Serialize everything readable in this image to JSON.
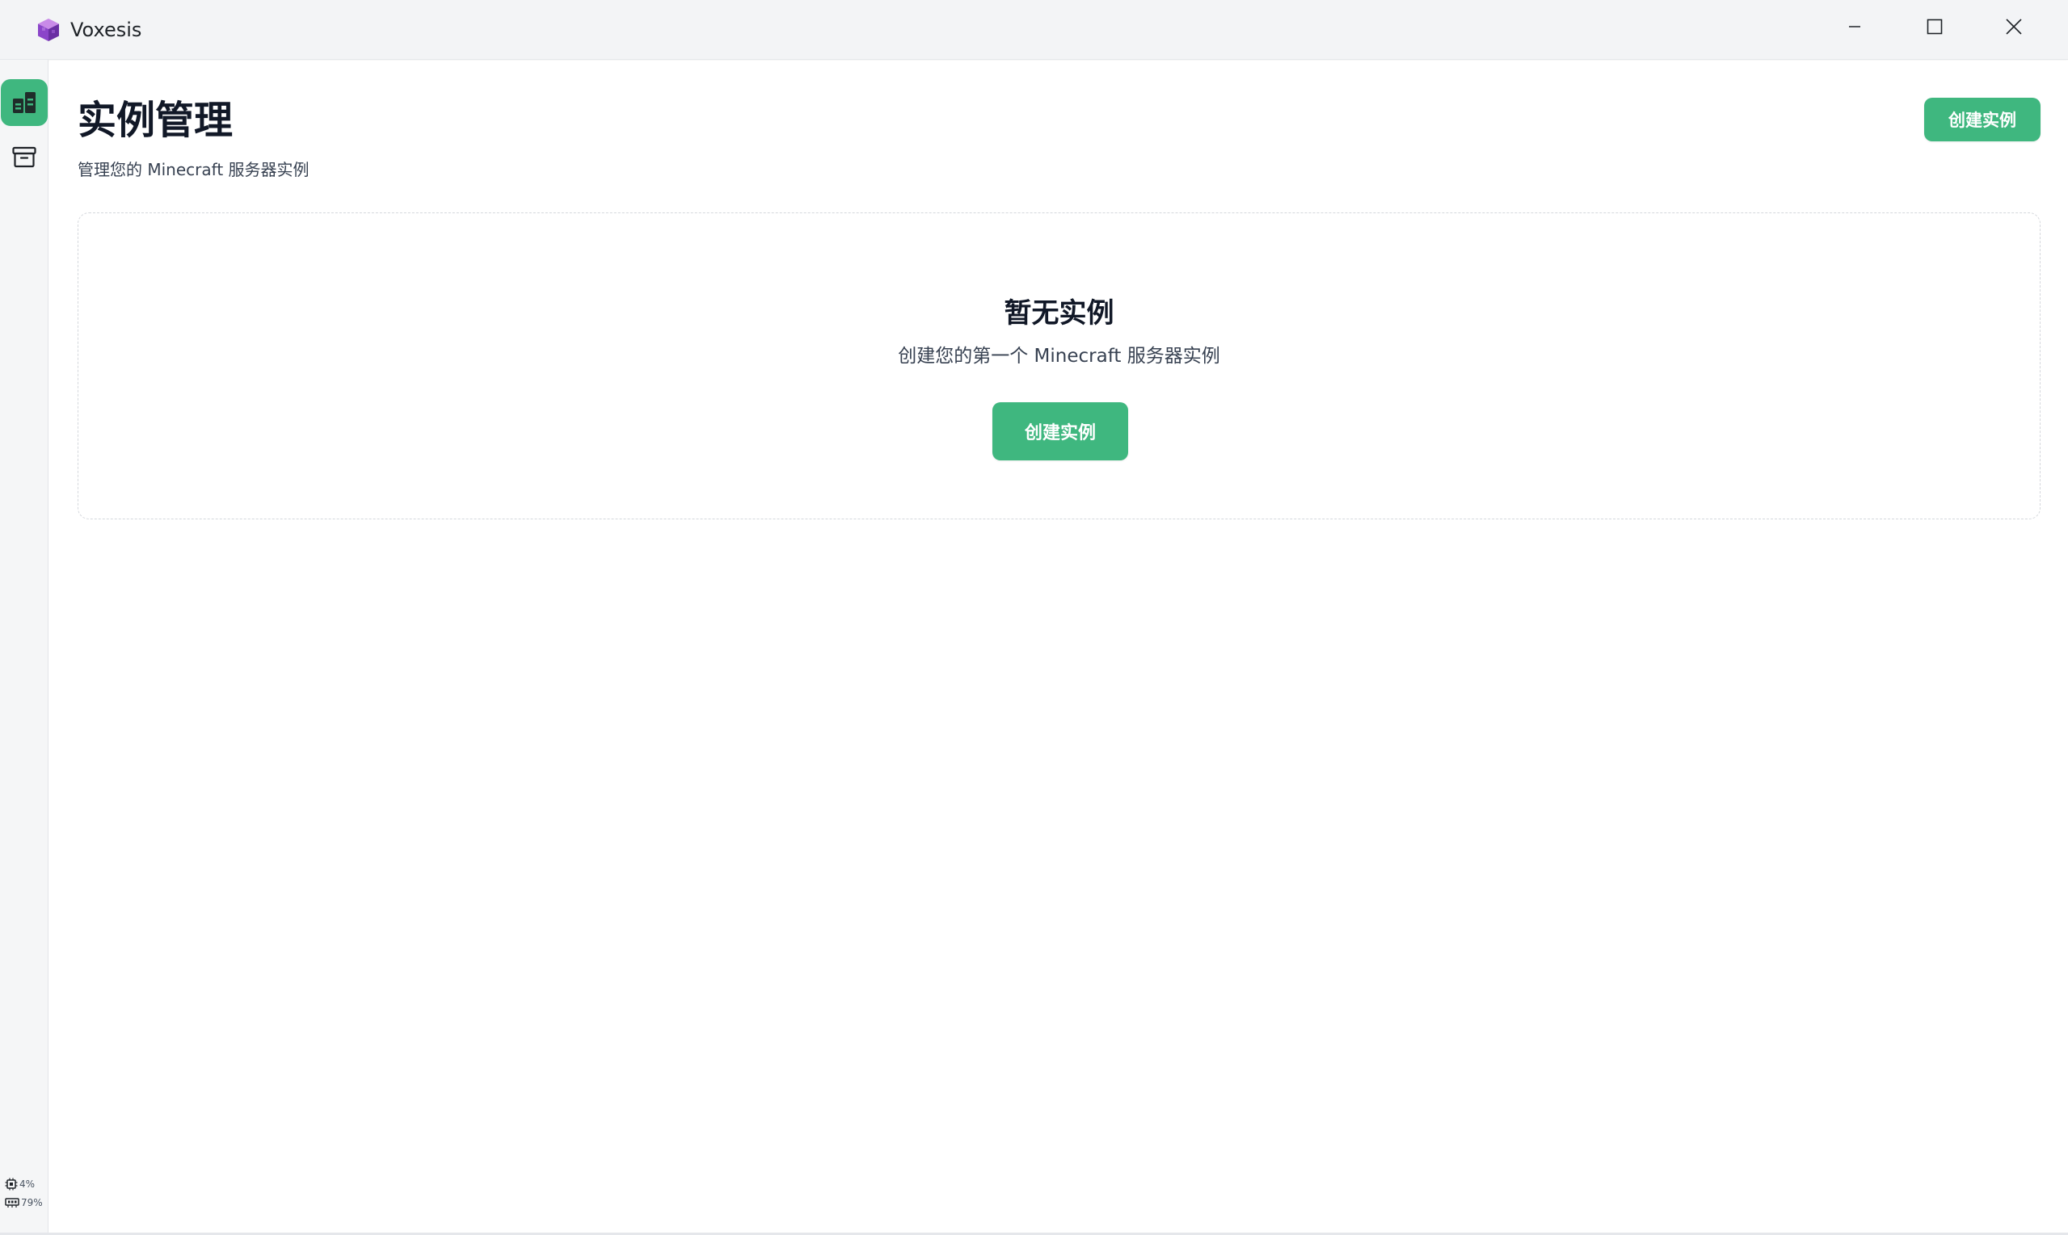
{
  "window": {
    "title": "Voxesis"
  },
  "sidebar": {
    "items": [
      {
        "name": "instances",
        "icon": "dashboard-icon",
        "active": true
      },
      {
        "name": "archive",
        "icon": "archive-icon",
        "active": false
      }
    ],
    "stats": {
      "cpu": "4%",
      "memory": "79%"
    }
  },
  "main": {
    "title": "实例管理",
    "subtitle": "管理您的 Minecraft 服务器实例",
    "create_button": "创建实例",
    "empty_state": {
      "title": "暂无实例",
      "description": "创建您的第一个 Minecraft 服务器实例",
      "button": "创建实例"
    }
  },
  "colors": {
    "accent": "#3fb77f",
    "app_icon": "#8b45c9"
  }
}
